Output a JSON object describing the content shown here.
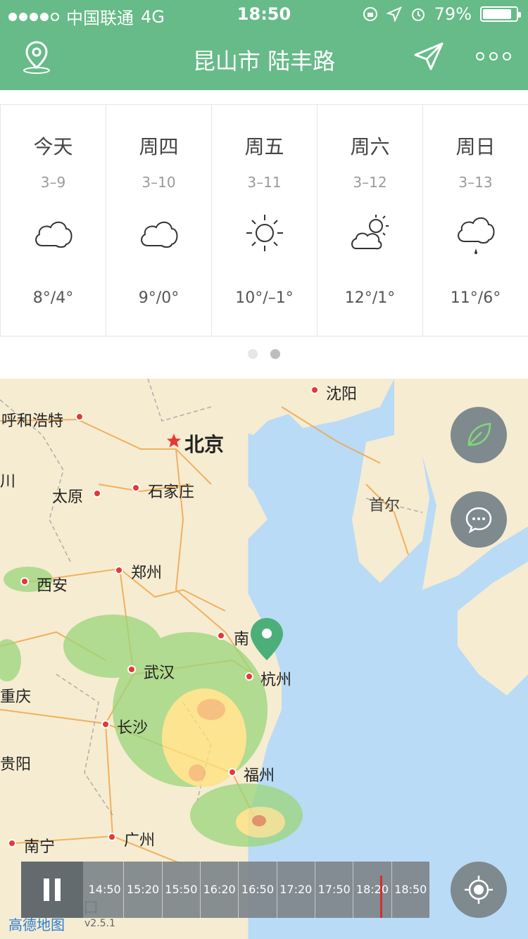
{
  "status_bar": {
    "carrier": "中国联通",
    "network": "4G",
    "time": "18:50",
    "battery": "79%"
  },
  "navbar": {
    "title": "昆山市 陆丰路"
  },
  "forecast": [
    {
      "day": "今天",
      "date": "3–9",
      "temp": "8°/4°",
      "icon": "cloudy-icon"
    },
    {
      "day": "周四",
      "date": "3–10",
      "temp": "9°/0°",
      "icon": "cloudy-icon"
    },
    {
      "day": "周五",
      "date": "3–11",
      "temp": "10°/–1°",
      "icon": "sunny-icon"
    },
    {
      "day": "周六",
      "date": "3–12",
      "temp": "12°/1°",
      "icon": "partly-cloudy-icon"
    },
    {
      "day": "周日",
      "date": "3–13",
      "temp": "11°/6°",
      "icon": "light-rain-icon"
    }
  ],
  "pager": {
    "active_index": 1,
    "count": 2
  },
  "map": {
    "cities": [
      "沈阳",
      "呼和浩特",
      "北京",
      "川",
      "太原",
      "石家庄",
      "首尔",
      "西安",
      "郑州",
      "南",
      "武汉",
      "杭州",
      "重庆",
      "长沙",
      "贵阳",
      "福州",
      "南宁",
      "广州",
      "口"
    ]
  },
  "timeline": {
    "times": [
      "14:50",
      "15:20",
      "15:50",
      "16:20",
      "16:50",
      "17:20",
      "17:50",
      "18:20",
      "18:50"
    ]
  },
  "footer": {
    "logo": "高德地图",
    "version": "v2.5.1"
  },
  "colors": {
    "primary": "#66bb88",
    "fab": "#7f8a8e",
    "marker": "#d32f2f"
  }
}
